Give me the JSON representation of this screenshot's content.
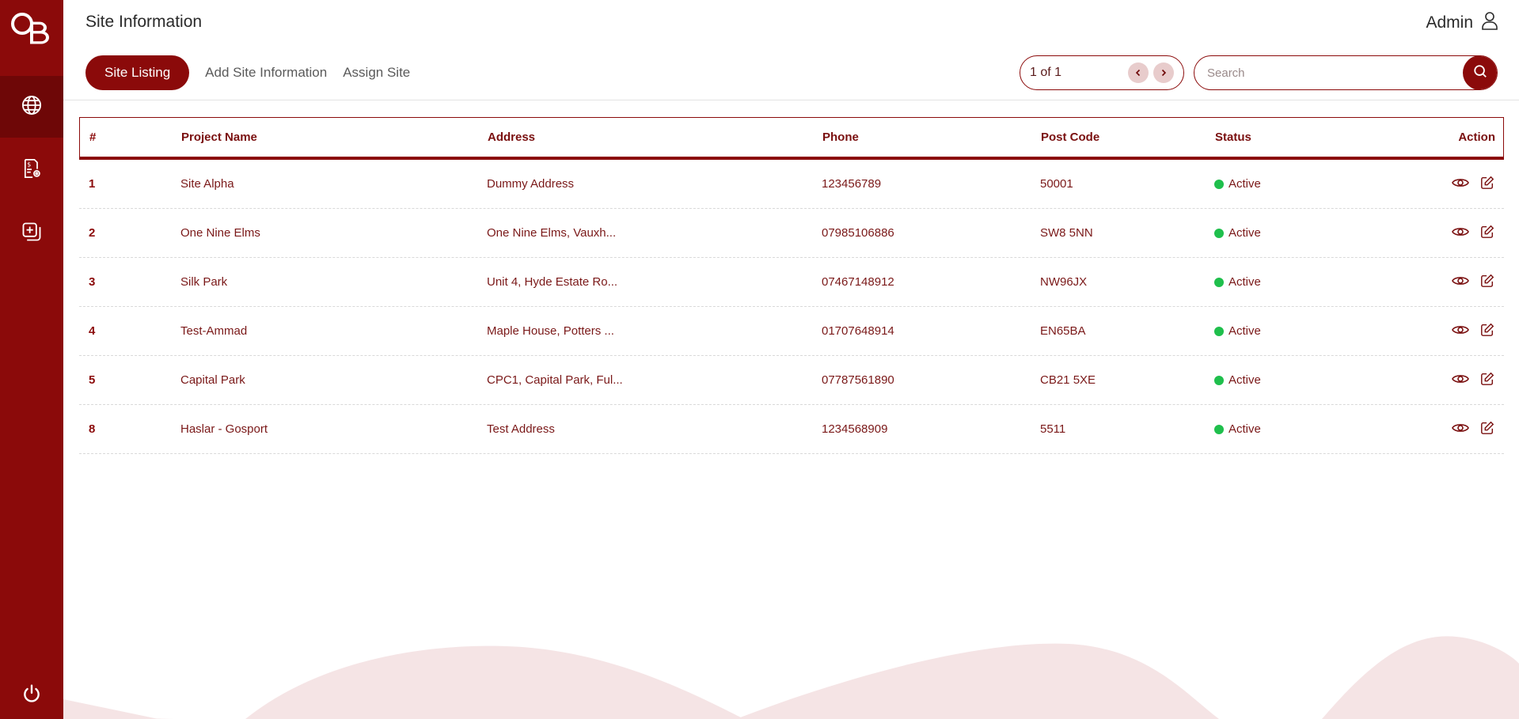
{
  "app": {
    "logo_text": "OB"
  },
  "header": {
    "title": "Site Information",
    "user_name": "Admin"
  },
  "tabs": [
    {
      "label": "Site Listing",
      "active": true
    },
    {
      "label": "Add Site Information",
      "active": false
    },
    {
      "label": "Assign Site",
      "active": false
    }
  ],
  "pagination": {
    "text": "1 of 1",
    "prev_icon": "chevron-left-icon",
    "next_icon": "chevron-right-icon"
  },
  "search": {
    "placeholder": "Search",
    "value": ""
  },
  "sidebar": {
    "items": [
      {
        "icon": "globe-icon",
        "active": true
      },
      {
        "icon": "invoice-settings-icon",
        "active": false
      },
      {
        "icon": "add-document-icon",
        "active": false
      }
    ],
    "logout_icon": "power-icon"
  },
  "table": {
    "headers": [
      "#",
      "Project Name",
      "Address",
      "Phone",
      "Post Code",
      "Status",
      "Action"
    ],
    "rows": [
      {
        "num": "1",
        "name": "Site Alpha",
        "address": "Dummy Address",
        "phone": "123456789",
        "post": "50001",
        "status": "Active"
      },
      {
        "num": "2",
        "name": "One Nine Elms",
        "address": "One Nine Elms, Vauxh...",
        "phone": "07985106886",
        "post": "SW8 5NN",
        "status": "Active"
      },
      {
        "num": "3",
        "name": "Silk Park",
        "address": "Unit 4, Hyde Estate Ro...",
        "phone": "07467148912",
        "post": "NW96JX",
        "status": "Active"
      },
      {
        "num": "4",
        "name": "Test-Ammad",
        "address": "Maple House, Potters ...",
        "phone": "01707648914",
        "post": "EN65BA",
        "status": "Active"
      },
      {
        "num": "5",
        "name": "Capital Park",
        "address": "CPC1, Capital Park, Ful...",
        "phone": "07787561890",
        "post": "CB21 5XE",
        "status": "Active"
      },
      {
        "num": "8",
        "name": "Haslar - Gosport",
        "address": "Test Address",
        "phone": "1234568909",
        "post": "5511",
        "status": "Active"
      }
    ]
  },
  "colors": {
    "brand": "#8b0a0a",
    "active_status": "#1fbf4c",
    "wave": "#f5e4e5"
  }
}
